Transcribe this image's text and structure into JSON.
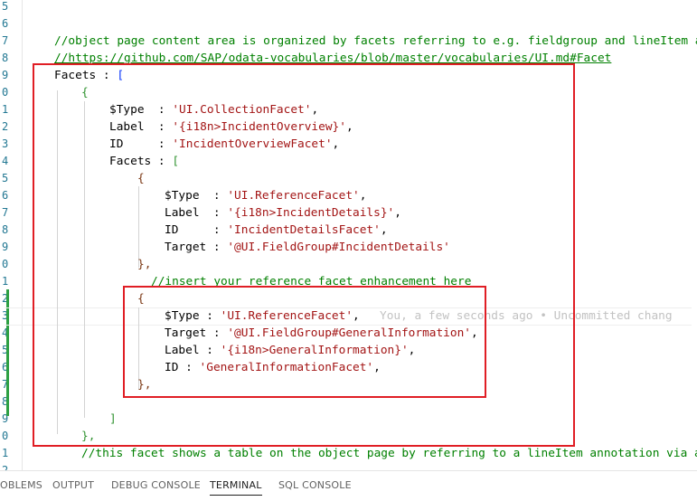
{
  "gutter": {
    "line_numbers": [
      "5",
      "6",
      "7",
      "8",
      "9",
      "0",
      "1",
      "2",
      "3",
      "4",
      "5",
      "6",
      "7",
      "8",
      "9",
      "0",
      "1",
      "2",
      "3",
      "4",
      "5",
      "6",
      "7",
      "8",
      "9",
      "0",
      "1",
      "2"
    ]
  },
  "code": {
    "comment_line": "//object page content area is organized by facets referring to e.g. fieldgroup and lineItem a",
    "link_line": "//https://github.com/SAP/odata-vocabularies/blob/master/vocabularies/UI.md#Facet",
    "facets_key": "Facets : ",
    "facets_open": "[",
    "brace_open_1": "{",
    "k_type": "$Type  : ",
    "v_type_collection": "'UI.CollectionFacet'",
    "k_label": "Label  : ",
    "v_label_overview": "'{i18n>IncidentOverview}'",
    "k_id": "ID     : ",
    "v_id_overview": "'IncidentOverviewFacet'",
    "inner_facets_key": "Facets : ",
    "inner_facets_open": "[",
    "brace_open_2": "{",
    "k_type2": "$Type  : ",
    "v_type_ref": "'UI.ReferenceFacet'",
    "k_label2": "Label  : ",
    "v_label_details": "'{i18n>IncidentDetails}'",
    "k_id2": "ID     : ",
    "v_id_details": "'IncidentDetailsFacet'",
    "k_target2": "Target : ",
    "v_target_details": "'@UI.FieldGroup#IncidentDetails'",
    "brace_close_2": "},",
    "insert_comment": "//insert your reference facet enhancement here",
    "brace_open_3": "{",
    "k_type3": "$Type : ",
    "v_type_ref3": "'UI.ReferenceFacet'",
    "k_target3": "Target : ",
    "v_target_general": "'@UI.FieldGroup#GeneralInformation'",
    "k_label3": "Label : ",
    "v_label_general": "'{i18n>GeneralInformation}'",
    "k_id3": "ID : ",
    "v_id_general": "'GeneralInformationFacet'",
    "brace_close_3": "},",
    "inner_facets_close": "]",
    "brace_close_1": "},",
    "bottom_comment": "//this facet shows a table on the object page by referring to a lineItem annotation via a",
    "blame_text": "You, a few seconds ago • Uncommitted chang"
  },
  "panel": {
    "tabs": [
      "OBLEMS",
      "OUTPUT",
      "DEBUG CONSOLE",
      "TERMINAL",
      "SQL CONSOLE"
    ],
    "active_tab": "TERMINAL"
  }
}
